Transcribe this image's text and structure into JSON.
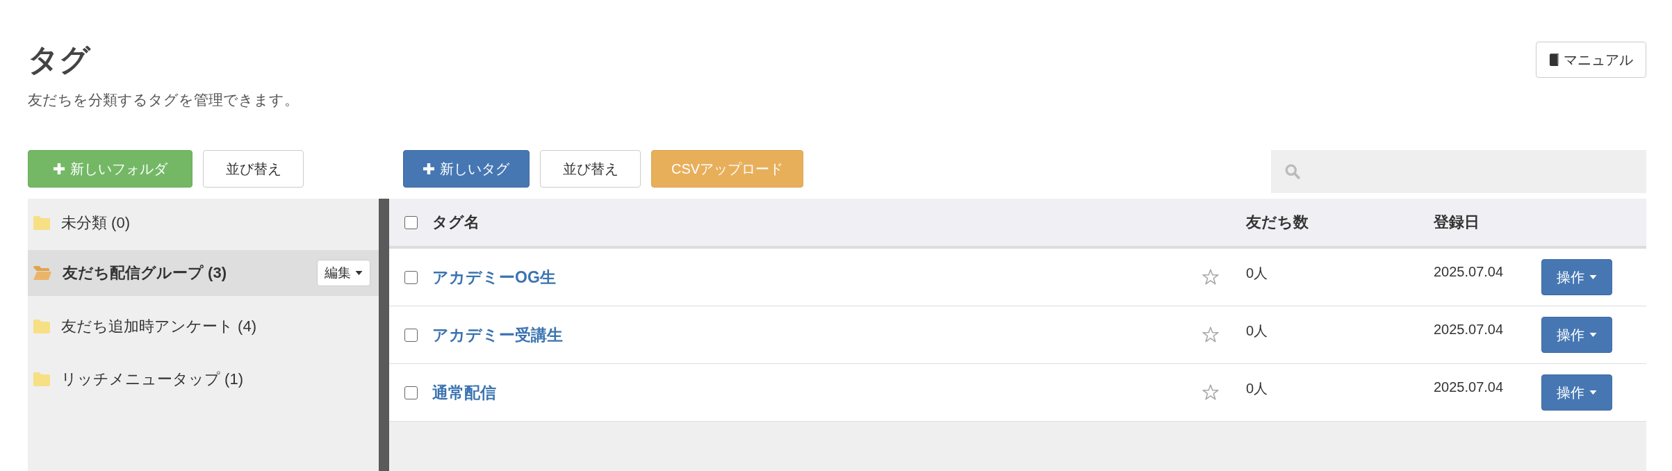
{
  "page": {
    "title": "タグ",
    "description": "友だちを分類するタグを管理できます。"
  },
  "manual_button": {
    "label": "マニュアル"
  },
  "folder_toolbar": [
    {
      "kind": "success",
      "label": "新しいフォルダ"
    },
    {
      "kind": "default",
      "label": "並び替え"
    }
  ],
  "tag_toolbar": [
    {
      "kind": "primary",
      "label": "新しいタグ"
    },
    {
      "kind": "default",
      "label": "並び替え"
    },
    {
      "kind": "warning",
      "label": "CSVアップロード"
    }
  ],
  "folders": [
    {
      "label": "未分類 (0)",
      "selected": false
    },
    {
      "label": "友だち配信グループ (3)",
      "selected": true,
      "edit_label": "編集"
    },
    {
      "label": "友だち追加時アンケート (4)",
      "selected": false
    },
    {
      "label": "リッチメニュータップ (1)",
      "selected": false
    }
  ],
  "table": {
    "select_all_checked": false,
    "columns": [
      "タグ名",
      "友だち数",
      "登録日"
    ],
    "rows": [
      {
        "checked": false,
        "name": "アカデミーOG生",
        "starred": false,
        "friends": "0人",
        "date": "2025.07.04",
        "action": "操作"
      },
      {
        "checked": false,
        "name": "アカデミー受講生",
        "starred": false,
        "friends": "0人",
        "date": "2025.07.04",
        "action": "操作"
      },
      {
        "checked": false,
        "name": "通常配信",
        "starred": false,
        "friends": "0人",
        "date": "2025.07.04",
        "action": "操作"
      }
    ]
  }
}
